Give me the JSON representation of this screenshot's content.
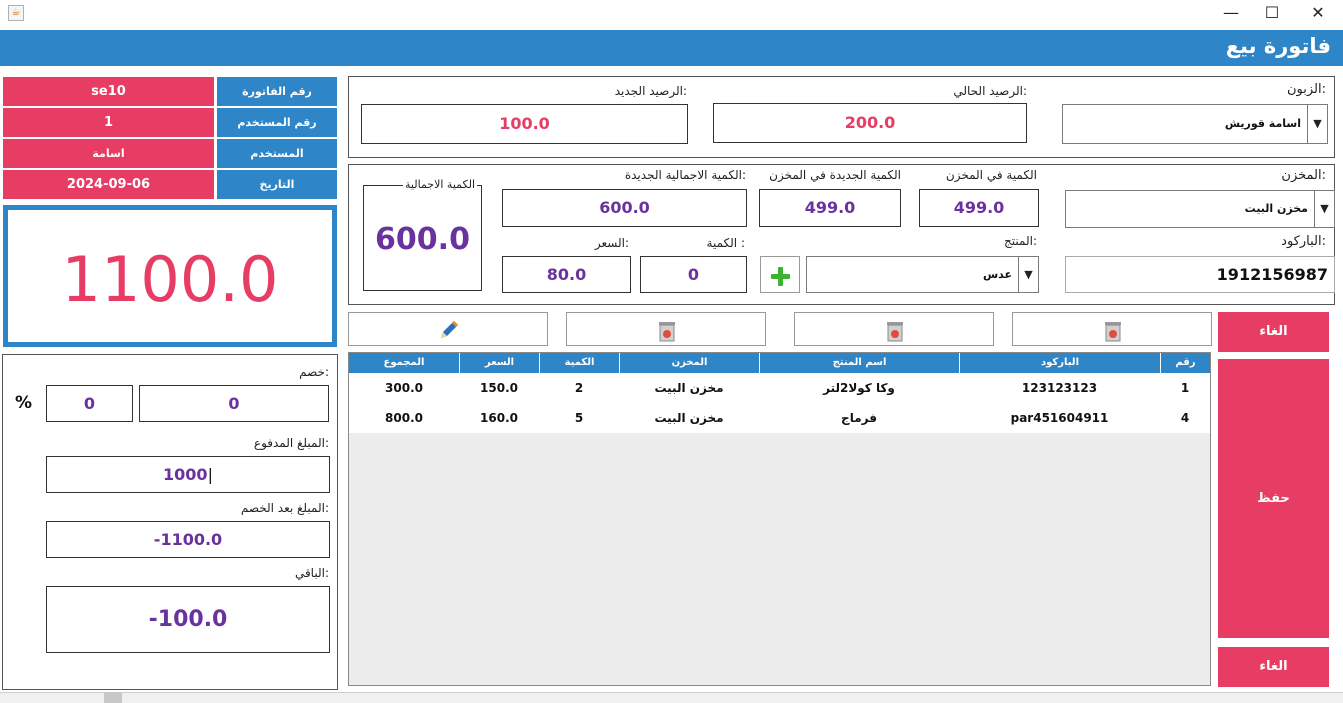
{
  "window": {
    "icon": "java-icon",
    "minimize_glyph": "—",
    "maximize_glyph": "☐",
    "close_glyph": "✕"
  },
  "header": {
    "title": "فاتورة بيع"
  },
  "info": {
    "invoice_number_label": "رقم الفاتورة",
    "invoice_number": "se10",
    "user_id_label": "رقم المستخدم",
    "user_id": "1",
    "user_label": "المستخدم",
    "user": "اسامة",
    "date_label": "التاريخ",
    "date": "2024-09-06"
  },
  "total_display": "1100.0",
  "payment": {
    "discount_label": "خصم:",
    "discount_value": "0",
    "discount_percent": "0",
    "percent_sign": "%",
    "paid_label": "المبلغ المدفوع:",
    "paid_value": "1000",
    "after_discount_label": "المبلغ بعد الخصم:",
    "after_discount_value": "-1100.0",
    "remaining_label": "الباقي:",
    "remaining_value": "-100.0"
  },
  "customer": {
    "customer_label": "الزبون:",
    "customer_value": "اسامة قوريش",
    "current_balance_label": "الرصيد الحالي:",
    "current_balance": "200.0",
    "new_balance_label": "الرصيد الجديد:",
    "new_balance": "100.0"
  },
  "stock": {
    "warehouse_label": "المخزن:",
    "warehouse_value": "مخزن البيت",
    "qty_in_stock_label": "الكمية في المخزن",
    "qty_in_stock": "499.0",
    "new_qty_in_stock_label": "الكمية الجديدة في المخزن",
    "new_qty_in_stock": "499.0",
    "new_total_qty_label": "الكمية الاجمالية الجديدة:",
    "new_total_qty": "600.0",
    "total_qty_label": "الكمية الاجمالية",
    "total_qty": "600.0",
    "barcode_label": "الباركود:",
    "barcode_value": "1912156987",
    "product_label": "المنتج:",
    "product_value": "عدس",
    "quantity_label": "الكمية :",
    "quantity_value": "0",
    "price_label": "السعر:",
    "price_value": "80.0"
  },
  "buttons": {
    "cancel_top": "الغاء",
    "save": "حفظ",
    "cancel_bottom": "الغاء"
  },
  "table": {
    "headers": [
      "رقم",
      "الباركود",
      "اسم المنتج",
      "المخزن",
      "الكمية",
      "السعر",
      "المجموع"
    ],
    "rows": [
      [
        "1",
        "123123123",
        "وكا كولا2لتر",
        "مخزن البيت",
        "2",
        "150.0",
        "300.0"
      ],
      [
        "4",
        "par451604911",
        "فرماج",
        "مخزن البيت",
        "5",
        "160.0",
        "800.0"
      ]
    ]
  }
}
